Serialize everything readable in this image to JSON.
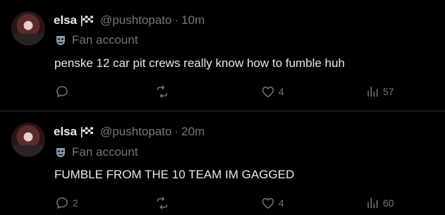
{
  "tweets": [
    {
      "name": "elsa",
      "handle": "@pushtopato",
      "dot": "·",
      "time": "10m",
      "badge": "Fan account",
      "text": "penske 12 car pit crews really know how to fumble huh",
      "replies": "",
      "retweets": "",
      "likes": "4",
      "views": "57"
    },
    {
      "name": "elsa",
      "handle": "@pushtopato",
      "dot": "·",
      "time": "20m",
      "badge": "Fan account",
      "text": "FUMBLE FROM THE 10 TEAM  IM GAGGED",
      "replies": "2",
      "retweets": "",
      "likes": "4",
      "views": "60"
    }
  ],
  "icons": {
    "flag": "checkered-flag-icon",
    "badge": "theater-mask-icon",
    "reply": "reply-icon",
    "retweet": "retweet-icon",
    "like": "heart-icon",
    "views": "views-icon"
  },
  "colors": {
    "background": "#000000",
    "text": "#e7e9ea",
    "muted": "#71767b",
    "divider": "#2f3336",
    "badge_icon": "#8b98a5"
  }
}
